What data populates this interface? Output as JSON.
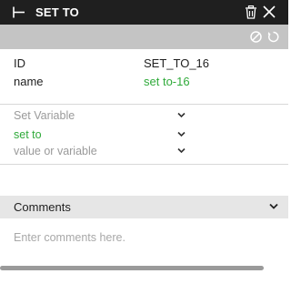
{
  "panel": {
    "title": "SET TO",
    "icons": {
      "node": "node-type-icon",
      "delete": "trash-icon",
      "close": "close-icon",
      "disable": "disable-icon",
      "reset": "reset-icon"
    }
  },
  "properties": {
    "id": {
      "label": "ID",
      "value": "SET_TO_16"
    },
    "name": {
      "label": "name",
      "value": "set to-16"
    }
  },
  "fields": {
    "variable": {
      "text": "Set Variable",
      "is_placeholder": true
    },
    "operation": {
      "text": "set to"
    },
    "value": {
      "text": "value or variable",
      "is_placeholder": true
    }
  },
  "comments": {
    "title": "Comments",
    "placeholder": "Enter comments here."
  },
  "colors": {
    "titlebar_bg": "#1f1f1f",
    "toolbar_bg": "#c4c4c4",
    "accent_green": "#2faa3a",
    "placeholder_gray": "#9a9a9a"
  }
}
